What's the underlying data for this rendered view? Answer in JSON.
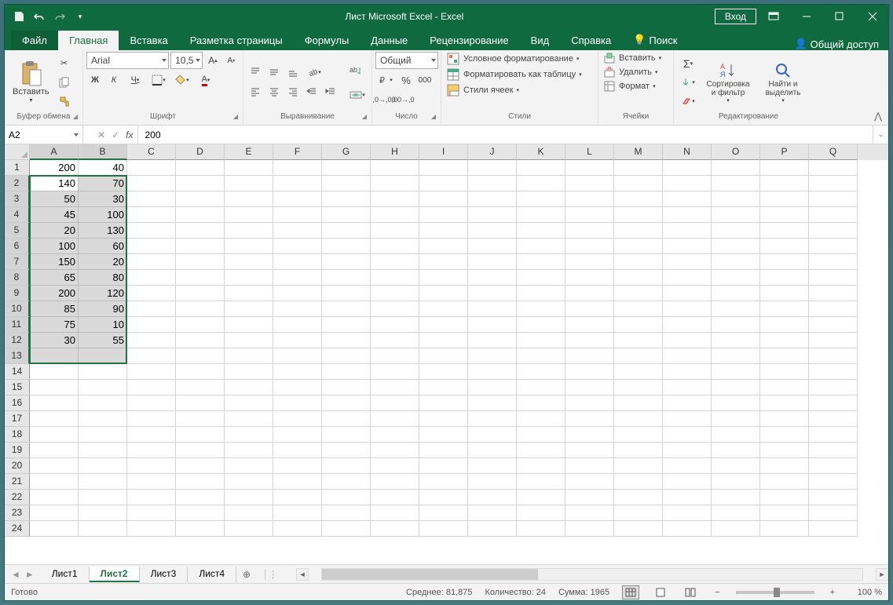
{
  "titlebar": {
    "title": "Лист Microsoft Excel - Excel",
    "signin": "Вход"
  },
  "tabs": {
    "file": "Файл",
    "items": [
      "Главная",
      "Вставка",
      "Разметка страницы",
      "Формулы",
      "Данные",
      "Рецензирование",
      "Вид",
      "Справка"
    ],
    "active_index": 0,
    "search": "Поиск",
    "share": "Общий доступ"
  },
  "ribbon": {
    "clipboard": {
      "paste": "Вставить",
      "label": "Буфер обмена"
    },
    "font": {
      "name": "Arial",
      "size": "10,5",
      "label": "Шрифт",
      "bold": "Ж",
      "italic": "К",
      "underline": "Ч"
    },
    "alignment": {
      "label": "Выравнивание"
    },
    "number": {
      "format": "Общий",
      "label": "Число"
    },
    "styles": {
      "cond": "Условное форматирование",
      "table": "Форматировать как таблицу",
      "cell": "Стили ячеек",
      "label": "Стили"
    },
    "cells": {
      "insert": "Вставить",
      "delete": "Удалить",
      "format": "Формат",
      "label": "Ячейки"
    },
    "editing": {
      "sort": "Сортировка и фильтр",
      "find": "Найти и выделить",
      "label": "Редактирование"
    }
  },
  "formula_bar": {
    "name_box": "A2",
    "formula": "200"
  },
  "grid": {
    "columns": [
      "A",
      "B",
      "C",
      "D",
      "E",
      "F",
      "G",
      "H",
      "I",
      "J",
      "K",
      "L",
      "M",
      "N",
      "O",
      "P",
      "Q"
    ],
    "selected_cols": [
      0,
      1
    ],
    "row_count": 24,
    "selected_rows_start": 2,
    "selected_rows_end": 13,
    "data": {
      "A": [
        "",
        "200",
        "140",
        "50",
        "45",
        "20",
        "100",
        "150",
        "65",
        "200",
        "85",
        "75",
        "30"
      ],
      "B": [
        "",
        "40",
        "70",
        "30",
        "100",
        "130",
        "60",
        "20",
        "80",
        "120",
        "90",
        "10",
        "55"
      ]
    },
    "active_cell": "A2"
  },
  "sheets": {
    "tabs": [
      "Лист1",
      "Лист2",
      "Лист3",
      "Лист4"
    ],
    "active_index": 1
  },
  "status": {
    "ready": "Готово",
    "avg_label": "Среднее:",
    "avg": "81,875",
    "count_label": "Количество:",
    "count": "24",
    "sum_label": "Сумма:",
    "sum": "1965",
    "zoom": "100 %"
  }
}
